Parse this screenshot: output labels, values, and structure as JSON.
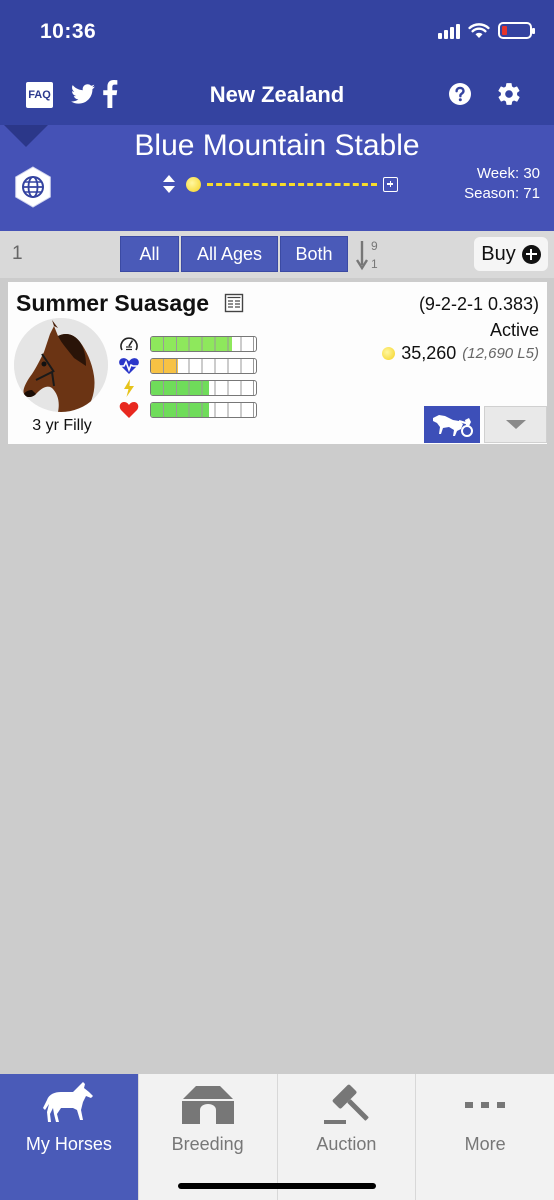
{
  "status_bar": {
    "time": "10:36"
  },
  "nav": {
    "faq_label": "FAQ",
    "title": "New Zealand",
    "icons": [
      "twitter-icon",
      "facebook-icon",
      "help-icon",
      "settings-icon"
    ]
  },
  "stable": {
    "name": "Blue Mountain Stable",
    "week_text": "Week: 30",
    "season_text": "Season: 71"
  },
  "filters": {
    "count": "1",
    "all_label": "All",
    "ages_label": "All Ages",
    "gender_label": "Both",
    "sort_top": "9",
    "sort_bottom": "1",
    "buy_label": "Buy"
  },
  "horse": {
    "name": "Summer Suasage",
    "record": "(9-2-2-1 0.383)",
    "status": "Active",
    "earnings": "35,260",
    "earnings_l5": "(12,690 L5)",
    "age_sex": "3 yr Filly",
    "stats": [
      {
        "icon": "speedometer-icon",
        "fill_fraction": 0.77,
        "color": "#8ee85c"
      },
      {
        "icon": "heart-rate-icon",
        "fill_fraction": 0.26,
        "color": "#f7c244"
      },
      {
        "icon": "lightning-icon",
        "fill_fraction": 0.55,
        "color": "#6fdc5a"
      },
      {
        "icon": "heart-icon",
        "fill_fraction": 0.55,
        "color": "#6fdc5a"
      }
    ]
  },
  "tabs": [
    {
      "label": "My Horses",
      "icon": "horse-icon",
      "active": true
    },
    {
      "label": "Breeding",
      "icon": "barn-icon",
      "active": false
    },
    {
      "label": "Auction",
      "icon": "gavel-icon",
      "active": false
    },
    {
      "label": "More",
      "icon": "more-dots-icon",
      "active": false
    }
  ],
  "colors": {
    "header": "#3443a0",
    "stable_panel": "#4552b6",
    "accent_button": "#4a5ab8",
    "background": "#cccccc"
  }
}
